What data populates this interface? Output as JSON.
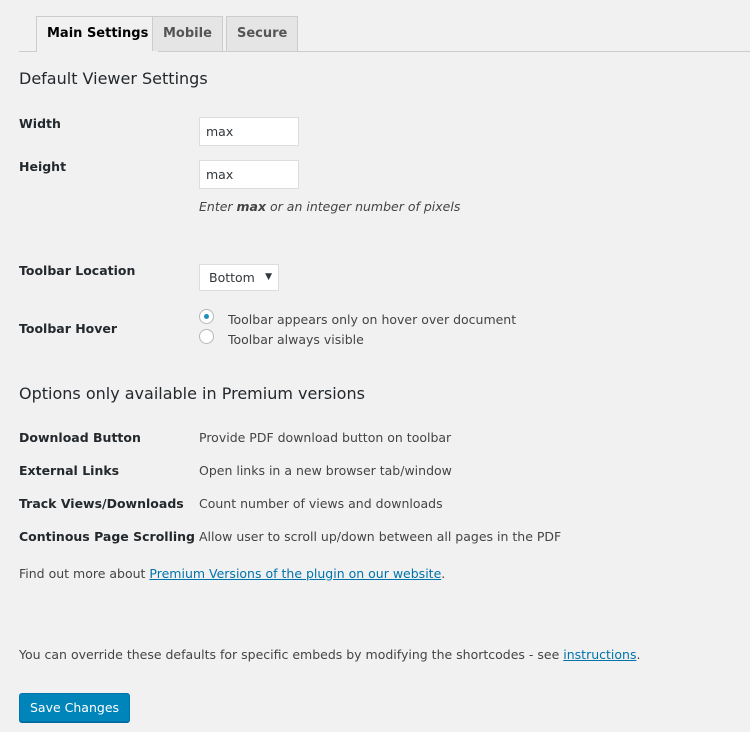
{
  "tabs": [
    "Main Settings",
    "Mobile",
    "Secure"
  ],
  "section1": {
    "title": "Default Viewer Settings",
    "width_label": "Width",
    "width_value": "max",
    "height_label": "Height",
    "height_value": "max",
    "hint_pre": "Enter ",
    "hint_bold": "max",
    "hint_post": " or an integer number of pixels",
    "toolbar_location_label": "Toolbar Location",
    "toolbar_location_value": "Bottom",
    "toolbar_hover_label": "Toolbar Hover",
    "hover_options": [
      "Toolbar appears only on hover over document",
      "Toolbar always visible"
    ],
    "hover_selected": 0
  },
  "section2": {
    "title": "Options only available in Premium versions",
    "rows": [
      {
        "label": "Download Button",
        "desc": "Provide PDF download button on toolbar"
      },
      {
        "label": "External Links",
        "desc": "Open links in a new browser tab/window"
      },
      {
        "label": "Track Views/Downloads",
        "desc": "Count number of views and downloads"
      },
      {
        "label": "Continous Page Scrolling",
        "desc": "Allow user to scroll up/down between all pages in the PDF"
      }
    ],
    "findout_pre": "Find out more about ",
    "findout_link": "Premium Versions of the plugin on our website",
    "findout_post": "."
  },
  "override": {
    "pre": "You can override these defaults for specific embeds by modifying the shortcodes - see ",
    "link": "instructions",
    "post": "."
  },
  "save_label": "Save Changes"
}
